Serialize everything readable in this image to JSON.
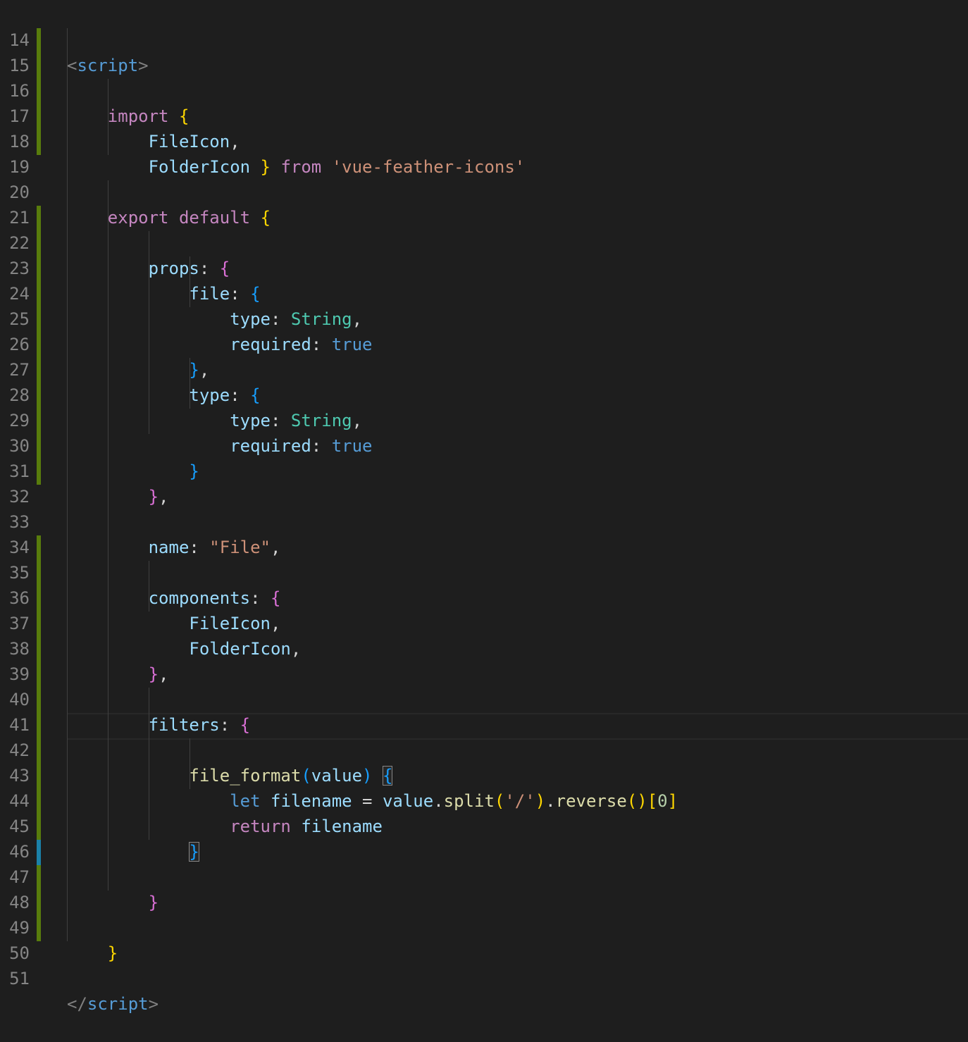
{
  "editor": {
    "colors": {
      "background": "#1e1e1e",
      "line_number": "#858585",
      "added_marker": "#587c0c",
      "modified_marker": "#1b81a8",
      "keyword": "#c586c0",
      "storage": "#569cd6",
      "variable": "#9cdcfe",
      "function": "#dcdcaa",
      "string": "#ce9178",
      "class": "#4ec9b0",
      "number": "#b5cea8",
      "bracket_level_1": "#ffd700",
      "bracket_level_2": "#da70d6",
      "bracket_level_3": "#179fff"
    },
    "lines": [
      {
        "num": "14",
        "t": [
          "<",
          "script",
          ">"
        ]
      },
      {
        "num": "15"
      },
      {
        "num": "16",
        "t": [
          "import",
          "{"
        ]
      },
      {
        "num": "17",
        "t": [
          "FileIcon",
          ","
        ]
      },
      {
        "num": "18",
        "t": [
          "FolderIcon",
          "}",
          "from",
          "'vue-feather-icons'"
        ]
      },
      {
        "num": "19"
      },
      {
        "num": "20",
        "t": [
          "export",
          "default",
          "{"
        ]
      },
      {
        "num": "21"
      },
      {
        "num": "22",
        "t": [
          "props",
          ":",
          "{"
        ]
      },
      {
        "num": "23",
        "t": [
          "file",
          ":",
          "{"
        ]
      },
      {
        "num": "24",
        "t": [
          "type",
          ":",
          "String",
          ","
        ]
      },
      {
        "num": "25",
        "t": [
          "required",
          ":",
          "true"
        ]
      },
      {
        "num": "26",
        "t": [
          "}",
          ","
        ]
      },
      {
        "num": "27",
        "t": [
          "type",
          ":",
          "{"
        ]
      },
      {
        "num": "28",
        "t": [
          "type",
          ":",
          "String",
          ","
        ]
      },
      {
        "num": "29",
        "t": [
          "required",
          ":",
          "true"
        ]
      },
      {
        "num": "30",
        "t": [
          "}"
        ]
      },
      {
        "num": "31",
        "t": [
          "}",
          ","
        ]
      },
      {
        "num": "32"
      },
      {
        "num": "33",
        "t": [
          "name",
          ":",
          "\"File\"",
          ","
        ]
      },
      {
        "num": "34"
      },
      {
        "num": "35",
        "t": [
          "components",
          ":",
          "{"
        ]
      },
      {
        "num": "36",
        "t": [
          "FileIcon",
          ","
        ]
      },
      {
        "num": "37",
        "t": [
          "FolderIcon",
          ","
        ]
      },
      {
        "num": "38",
        "t": [
          "}",
          ","
        ]
      },
      {
        "num": "39"
      },
      {
        "num": "40",
        "t": [
          "filters",
          ":",
          "{"
        ]
      },
      {
        "num": "41"
      },
      {
        "num": "42",
        "t": [
          "file_format",
          "(",
          "value",
          ")",
          "{"
        ]
      },
      {
        "num": "43",
        "t": [
          "let",
          "filename",
          "=",
          "value",
          ".",
          "split",
          "(",
          "'/'",
          ")",
          ".",
          "reverse",
          "()",
          "[",
          "0",
          "]"
        ]
      },
      {
        "num": "44",
        "t": [
          "return",
          "filename"
        ]
      },
      {
        "num": "45",
        "t": [
          "}"
        ]
      },
      {
        "num": "46"
      },
      {
        "num": "47",
        "t": [
          "}"
        ]
      },
      {
        "num": "48"
      },
      {
        "num": "49",
        "t": [
          "}"
        ]
      },
      {
        "num": "50"
      },
      {
        "num": "51",
        "t": [
          "</",
          "script",
          ">"
        ]
      }
    ]
  }
}
